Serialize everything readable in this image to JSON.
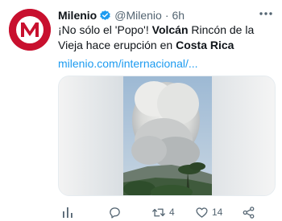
{
  "author": {
    "name": "Milenio",
    "handle": "@Milenio",
    "separator": "·",
    "time": "6h",
    "avatar_letter": "M"
  },
  "tweet": {
    "text_part1": "¡No sólo el 'Popo'! ",
    "text_bold1": "Volcán",
    "text_part2": " Rincón de la Vieja hace erupción en ",
    "text_bold2": "Costa Rica",
    "link": "milenio.com/internacional/..."
  },
  "actions": {
    "views_count": "",
    "replies_count": "",
    "retweets_count": "4",
    "likes_count": "14"
  },
  "icons": {
    "verified": "verified-badge-icon",
    "more": "more-options-icon",
    "views": "analytics-icon",
    "reply": "reply-icon",
    "retweet": "retweet-icon",
    "like": "heart-icon",
    "share": "share-icon"
  },
  "colors": {
    "brand": "#c8102e",
    "link": "#1d9bf0",
    "verified": "#1d9bf0",
    "secondary_text": "#536471"
  }
}
